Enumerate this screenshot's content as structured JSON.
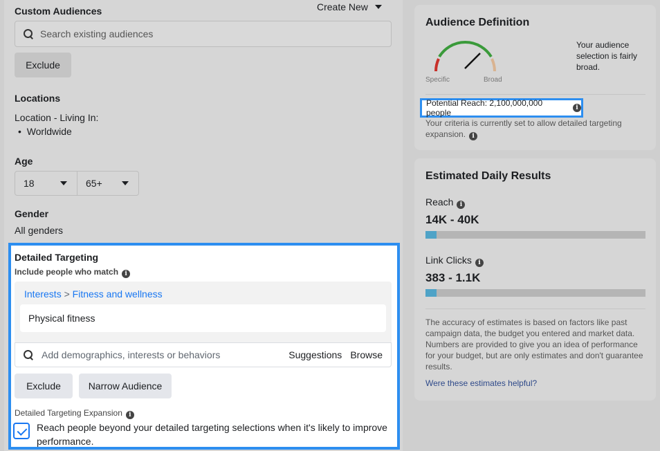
{
  "custom_audiences": {
    "title": "Custom Audiences",
    "create_new_label": "Create New",
    "search_placeholder": "Search existing audiences",
    "exclude_label": "Exclude"
  },
  "locations": {
    "title": "Locations",
    "living_in_label": "Location - Living In:",
    "items": [
      "Worldwide"
    ]
  },
  "age": {
    "title": "Age",
    "min": "18",
    "max": "65+"
  },
  "gender": {
    "title": "Gender",
    "value": "All genders"
  },
  "detailed_targeting": {
    "title": "Detailed Targeting",
    "include_label": "Include people who match",
    "breadcrumb_parent": "Interests",
    "breadcrumb_sep": ">",
    "breadcrumb_child": "Fitness and wellness",
    "selected_interest": "Physical fitness",
    "search_placeholder": "Add demographics, interests or behaviors",
    "suggestions_label": "Suggestions",
    "browse_label": "Browse",
    "exclude_label": "Exclude",
    "narrow_label": "Narrow Audience",
    "expansion_title": "Detailed Targeting Expansion",
    "expansion_checked": true,
    "expansion_line1": "Reach people beyond your detailed targeting selections when it's likely to improve",
    "expansion_line2": "performance."
  },
  "audience_definition": {
    "title": "Audience Definition",
    "gauge_left_label": "Specific",
    "gauge_right_label": "Broad",
    "summary_line1": "Your audience",
    "summary_line2": "selection is fairly",
    "summary_line3": "broad.",
    "potential_reach": "Potential Reach: 2,100,000,000 people",
    "criteria_line1": "Your criteria is currently set to allow detailed targeting",
    "criteria_line2": "expansion."
  },
  "estimated_daily_results": {
    "title": "Estimated Daily Results",
    "reach_label": "Reach",
    "reach_value": "14K - 40K",
    "reach_fill_fraction": 0.05,
    "clicks_label": "Link Clicks",
    "clicks_value": "383 - 1.1K",
    "clicks_fill_fraction": 0.05,
    "disclaimer": [
      "The accuracy of estimates is based on factors like past",
      "campaign data, the budget you entered and market data.",
      "Numbers are provided to give you an idea of performance",
      "for your budget, but are only estimates and don't guarantee",
      "results."
    ],
    "feedback_link": "Were these estimates helpful?"
  },
  "colors": {
    "highlight": "#2d8ef0",
    "link": "#1877f2",
    "bar_fill": "#4fa3c7"
  }
}
